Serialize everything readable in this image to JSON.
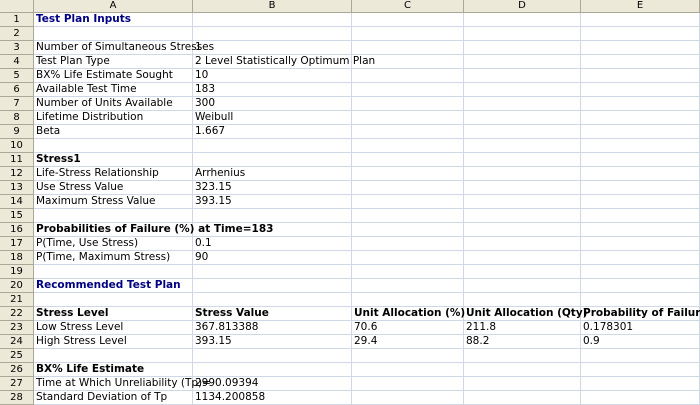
{
  "columns": [
    "A",
    "B",
    "C",
    "D",
    "E"
  ],
  "rows": [
    {
      "n": "1",
      "a": "Test Plan Inputs",
      "a_style": "title",
      "b": "",
      "c": "",
      "d": "",
      "e": ""
    },
    {
      "n": "2",
      "a": "",
      "b": "",
      "c": "",
      "d": "",
      "e": ""
    },
    {
      "n": "3",
      "a": "Number of Simultaneous Stresses",
      "b": "1",
      "c": "",
      "d": "",
      "e": ""
    },
    {
      "n": "4",
      "a": "Test Plan Type",
      "b": "2 Level Statistically Optimum Plan",
      "c": "",
      "d": "",
      "e": ""
    },
    {
      "n": "5",
      "a": "BX% Life Estimate Sought",
      "b": "10",
      "c": "",
      "d": "",
      "e": ""
    },
    {
      "n": "6",
      "a": "Available Test Time",
      "b": "183",
      "c": "",
      "d": "",
      "e": ""
    },
    {
      "n": "7",
      "a": "Number of Units Available",
      "b": "300",
      "c": "",
      "d": "",
      "e": ""
    },
    {
      "n": "8",
      "a": "Lifetime Distribution",
      "b": "Weibull",
      "c": "",
      "d": "",
      "e": ""
    },
    {
      "n": "9",
      "a": "Beta",
      "b": "1.667",
      "c": "",
      "d": "",
      "e": ""
    },
    {
      "n": "10",
      "a": "",
      "b": "",
      "c": "",
      "d": "",
      "e": ""
    },
    {
      "n": "11",
      "a": "Stress1",
      "a_style": "bold",
      "b": "",
      "c": "",
      "d": "",
      "e": ""
    },
    {
      "n": "12",
      "a": "Life-Stress Relationship",
      "b": "Arrhenius",
      "c": "",
      "d": "",
      "e": ""
    },
    {
      "n": "13",
      "a": "Use Stress Value",
      "b": "323.15",
      "c": "",
      "d": "",
      "e": ""
    },
    {
      "n": "14",
      "a": "Maximum Stress Value",
      "b": "393.15",
      "c": "",
      "d": "",
      "e": ""
    },
    {
      "n": "15",
      "a": "",
      "b": "",
      "c": "",
      "d": "",
      "e": ""
    },
    {
      "n": "16",
      "a": "Probabilities of Failure (%) at Time=183",
      "a_style": "bold",
      "b": "",
      "c": "",
      "d": "",
      "e": ""
    },
    {
      "n": "17",
      "a": "P(Time, Use Stress)",
      "b": "0.1",
      "c": "",
      "d": "",
      "e": ""
    },
    {
      "n": "18",
      "a": "P(Time, Maximum Stress)",
      "b": "90",
      "c": "",
      "d": "",
      "e": ""
    },
    {
      "n": "19",
      "a": "",
      "b": "",
      "c": "",
      "d": "",
      "e": ""
    },
    {
      "n": "20",
      "a": "Recommended Test Plan",
      "a_style": "title",
      "b": "",
      "c": "",
      "d": "",
      "e": ""
    },
    {
      "n": "21",
      "a": "",
      "b": "",
      "c": "",
      "d": "",
      "e": ""
    },
    {
      "n": "22",
      "a": "Stress Level",
      "a_style": "bold",
      "b": "Stress Value",
      "b_style": "bold",
      "c": "Unit Allocation (%)",
      "c_style": "bold",
      "d": "Unit Allocation (Qty)",
      "d_style": "bold",
      "e": "Probability of Failure",
      "e_style": "bold"
    },
    {
      "n": "23",
      "a": "Low Stress Level",
      "b": "367.813388",
      "c": "70.6",
      "d": "211.8",
      "e": "0.178301"
    },
    {
      "n": "24",
      "a": "High Stress Level",
      "b": "393.15",
      "c": "29.4",
      "d": "88.2",
      "e": "0.9"
    },
    {
      "n": "25",
      "a": "",
      "b": "",
      "c": "",
      "d": "",
      "e": ""
    },
    {
      "n": "26",
      "a": "BX% Life Estimate",
      "a_style": "bold",
      "b": "",
      "c": "",
      "d": "",
      "e": ""
    },
    {
      "n": "27",
      "a": "Time at Which Unreliability (Tp)=",
      "b": "2990.09394",
      "c": "",
      "d": "",
      "e": ""
    },
    {
      "n": "28",
      "a": "Standard Deviation of Tp",
      "b": "1134.200858",
      "c": "",
      "d": "",
      "e": ""
    }
  ]
}
